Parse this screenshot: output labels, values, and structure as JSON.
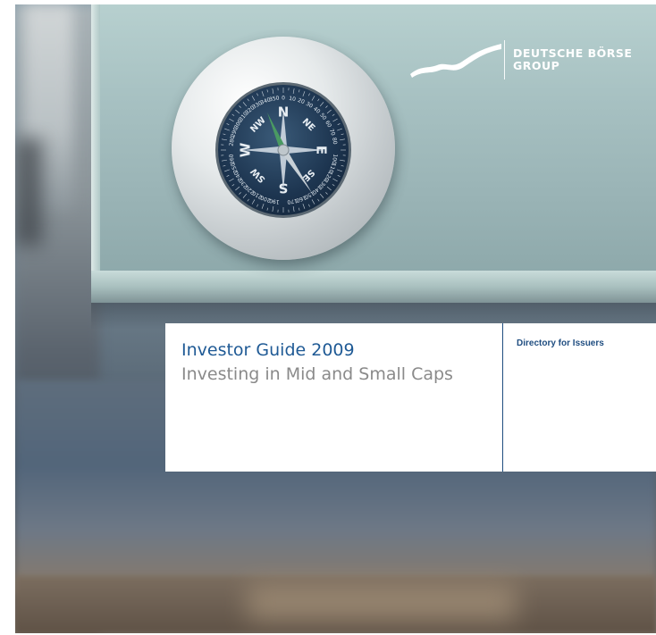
{
  "cover": {
    "title": "Investor Guide 2009",
    "subtitle": "Investing in Mid and Small Caps",
    "side_label": "Directory for Issuers"
  },
  "logo": {
    "line1": "DEUTSCHE BÖRSE",
    "line2": "GROUP",
    "icon": "wave-logo-icon"
  },
  "compass": {
    "icon": "compass-icon",
    "directions": [
      "N",
      "NE",
      "E",
      "SE",
      "S",
      "SW",
      "W",
      "NW"
    ],
    "degree_marks": [
      "0",
      "10",
      "20",
      "30",
      "40",
      "50",
      "60",
      "70",
      "80",
      "100",
      "110",
      "120",
      "130",
      "140",
      "150",
      "160",
      "170",
      "190",
      "200",
      "210",
      "220",
      "230",
      "240",
      "250",
      "260",
      "280",
      "290",
      "300",
      "310",
      "320",
      "330",
      "340",
      "350"
    ]
  },
  "colors": {
    "title_blue": "#1f5a95",
    "subtitle_gray": "#8a8a8a",
    "divider_blue": "#1f4d80"
  }
}
